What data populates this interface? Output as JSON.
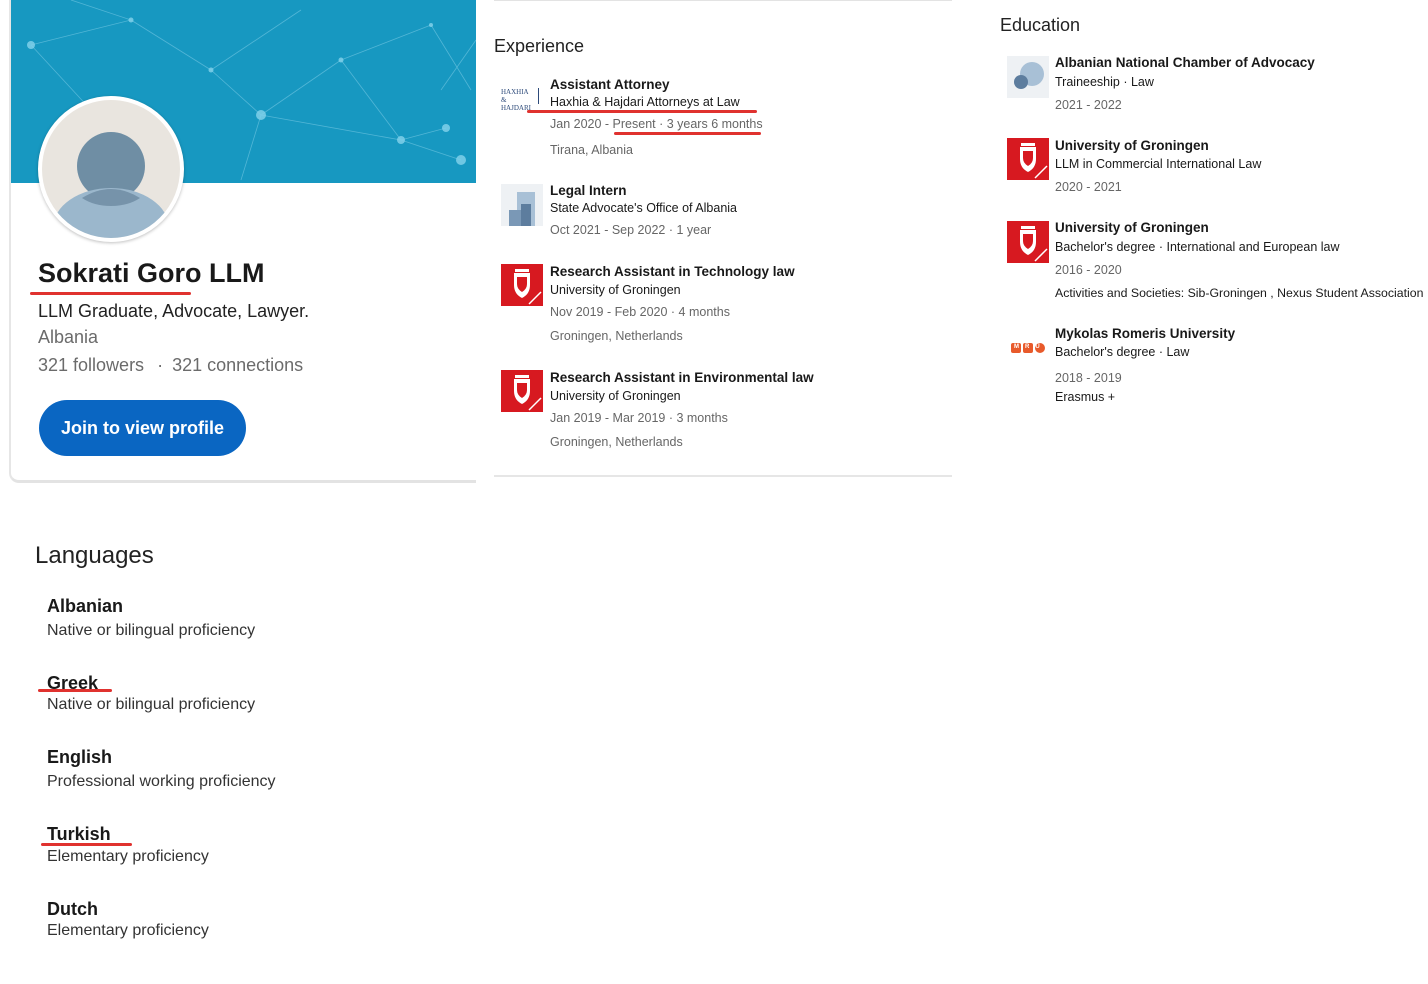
{
  "profile": {
    "name": "Sokrati Goro LLM",
    "headline": "LLM Graduate, Advocate, Lawyer.",
    "location": "Albania",
    "followers": "321 followers",
    "separator": "·",
    "connections": "321 connections",
    "join_button": "Join to view profile",
    "cover_color": "#1798c1",
    "button_color": "#0a66c2",
    "annotation_color": "#e0322f"
  },
  "experience": {
    "title": "Experience",
    "items": [
      {
        "title": "Assistant Attorney",
        "company": "Haxhia & Hajdari Attorneys at Law",
        "dates": "Jan 2020 - Present · 3 years 6 months",
        "location": "Tirana, Albania",
        "logo": "haxhia-hajdari-logo",
        "logo_text": "HAXHIA & HAJDARI"
      },
      {
        "title": "Legal Intern",
        "company": "State Advocate's Office of Albania",
        "dates": "Oct 2021 - Sep 2022 · 1 year",
        "location": "",
        "logo": "building-placeholder-logo"
      },
      {
        "title": "Research Assistant in Technology law",
        "company": "University of Groningen",
        "dates": "Nov 2019 - Feb 2020 · 4 months",
        "location": "Groningen, Netherlands",
        "logo": "university-of-groningen-logo"
      },
      {
        "title": "Research Assistant in Environmental law",
        "company": "University of Groningen",
        "dates": "Jan 2019 - Mar 2019 · 3 months",
        "location": "Groningen, Netherlands",
        "logo": "university-of-groningen-logo"
      }
    ]
  },
  "education": {
    "title": "Education",
    "items": [
      {
        "school": "Albanian National Chamber of Advocacy",
        "degree": "Traineeship · Law",
        "dates": "2021 - 2022",
        "extra": "",
        "logo": "school-placeholder-logo"
      },
      {
        "school": "University of Groningen",
        "degree": "LLM in Commercial International Law",
        "dates": "2020 - 2021",
        "extra": "",
        "logo": "university-of-groningen-logo"
      },
      {
        "school": "University of Groningen",
        "degree": "Bachelor's degree · International and European law",
        "dates": "2016 - 2020",
        "extra": "Activities and Societies: Sib-Groningen , Nexus Student Association",
        "logo": "university-of-groningen-logo"
      },
      {
        "school": "Mykolas Romeris University",
        "degree": "Bachelor's degree · Law",
        "dates": "2018 - 2019",
        "extra": "Erasmus +",
        "logo": "mykolas-romeris-logo",
        "logo_text": "MRU"
      }
    ]
  },
  "languages": {
    "title": "Languages",
    "items": [
      {
        "name": "Albanian",
        "level": "Native or bilingual proficiency"
      },
      {
        "name": "Greek",
        "level": "Native or bilingual proficiency"
      },
      {
        "name": "English",
        "level": "Professional working proficiency"
      },
      {
        "name": "Turkish",
        "level": "Elementary proficiency"
      },
      {
        "name": "Dutch",
        "level": "Elementary proficiency"
      }
    ]
  }
}
